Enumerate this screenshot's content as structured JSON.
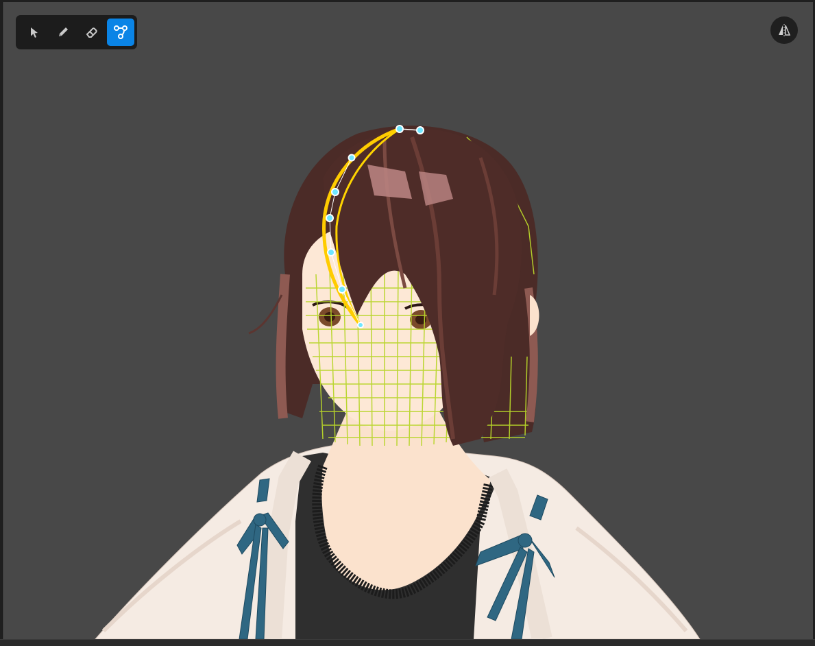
{
  "toolbar": {
    "tools": [
      {
        "name": "select",
        "icon": "pointer-arrow-icon",
        "active": false
      },
      {
        "name": "draw",
        "icon": "pencil-icon",
        "active": false
      },
      {
        "name": "erase",
        "icon": "eraser-icon",
        "active": false
      },
      {
        "name": "curve-edit",
        "icon": "bezier-nodes-icon",
        "active": true
      }
    ]
  },
  "mirror_button": {
    "icon": "mirror-symmetry-icon"
  },
  "colors": {
    "viewport_bg": "#484848",
    "toolbar_bg": "#1c1c1c",
    "active_tool": "#0a84e6",
    "curve_stroke": "#ffcc00",
    "control_point": "#6fe6ff",
    "mesh_wire": "#b8d62a",
    "hair": "#4a2a26",
    "skin": "#fde6d2",
    "cardigan": "#f7ece3",
    "ribbon": "#2f6782",
    "top": "#2e2e2e"
  }
}
